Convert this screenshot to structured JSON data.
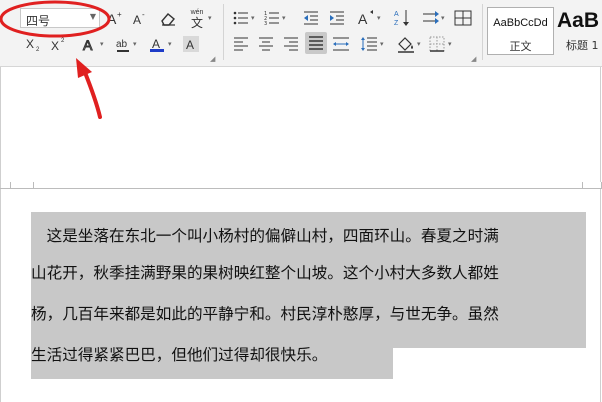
{
  "ribbon": {
    "font_size_value": "四号",
    "pinyin_label": "wén",
    "style_normal_preview": "AaBbCcDd",
    "style_normal_label": "正文",
    "style_heading_preview": "AaB",
    "style_heading_label": "标题 1"
  },
  "document": {
    "paragraph_lines": [
      "　这是坐落在东北一个叫小杨村的偏僻山村，四面环山。春夏之时满",
      "山花开，秋季挂满野果的果树映红整个山坡。这个小村大多数人都姓",
      "杨，几百年来都是如此的平静宁和。村民淳朴憨厚，与世无争。虽然",
      "生活过得紧紧巴巴，但他们过得却很快乐。"
    ]
  },
  "annotation": {
    "color": "#e02020"
  }
}
